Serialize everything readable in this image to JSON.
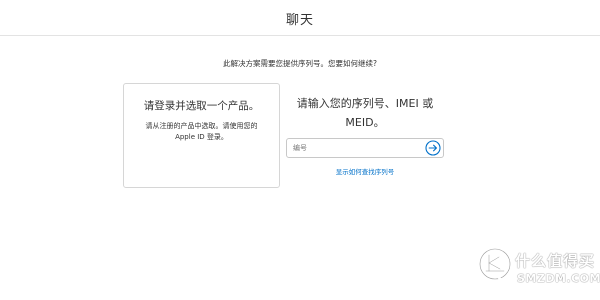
{
  "header": {
    "title": "聊天"
  },
  "prompt": {
    "text": "此解决方案需要您提供序列号。您要如何继续?"
  },
  "signin_card": {
    "title": "请登录并选取一个产品。",
    "description": "请从注册的产品中选取。请使用您的 Apple ID 登录。"
  },
  "serial": {
    "heading": "请输入您的序列号、IMEI 或 MEID。",
    "placeholder": "编号",
    "value": "",
    "submit_icon": "arrow-right-circle-icon",
    "help_link": "显示如何查找序列号"
  },
  "watermark": {
    "text_cn": "什么值得买",
    "text_en": "SMZDM.COM"
  },
  "colors": {
    "accent": "#0070c9",
    "border": "#d6d6d6",
    "text": "#333333"
  }
}
